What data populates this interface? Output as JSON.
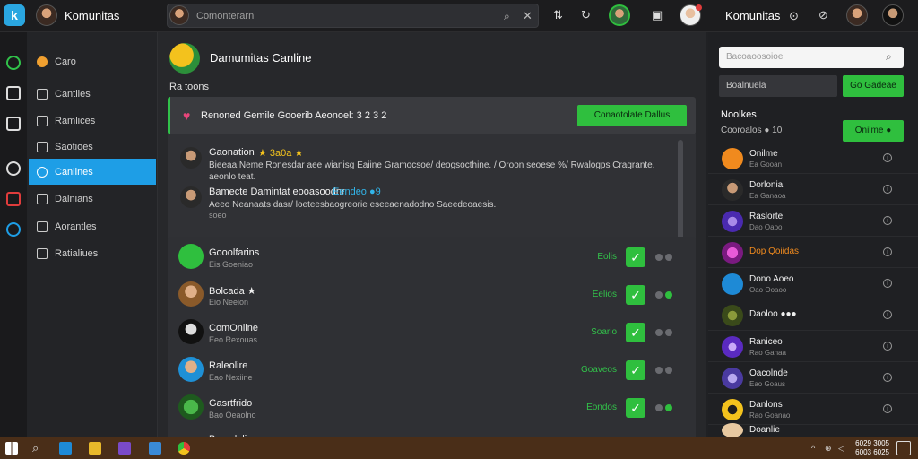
{
  "topbar": {
    "app_title": "Komunitas",
    "search_placeholder": "Comonterarn",
    "right_title": "Komunitas",
    "right_title_glyph": "⊙"
  },
  "nav": {
    "items": [
      {
        "label": "Caro"
      },
      {
        "label": "Cantlies"
      },
      {
        "label": "Ramlices"
      },
      {
        "label": "Saotioes"
      },
      {
        "label": "Canlines",
        "active": true
      },
      {
        "label": "Dalnians"
      },
      {
        "label": "Aorantles"
      },
      {
        "label": "Ratialiues"
      }
    ]
  },
  "main": {
    "title": "Damumitas Canline",
    "section_label": "Ra toons",
    "banner": {
      "text": "Renoned Gemile Gooerib Aeonoel: 3 2 3 2",
      "button": "Conaotolate Dallus"
    },
    "posts": [
      {
        "name": "Gaonation",
        "stars": "★ 3a0a ★",
        "text": "Bieeaa Neme Ronesdar aee wianisg Eaiine Gramocsoe/ deogsocthine. / Oroon seoese %/ Rwalogps Cragrante. aeonlo teat.",
        "sub": ""
      },
      {
        "name": "Bamecte Damintat eooasoodnr",
        "tag": "Eendeo ●9",
        "text": "Aeeo Neanaats dasr/ loeteesbaogreorie eseeaenadodno Saeedeoaesis.",
        "sub": "soeo"
      }
    ],
    "members": [
      {
        "name": "Gooolfarins",
        "sub": "Eis Goeniao",
        "status": "Eolis",
        "color": "#2fbf3e"
      },
      {
        "name": "Bolcada ★",
        "sub": "Eio Neeion",
        "status": "Eelios",
        "color": "#c08a5a"
      },
      {
        "name": "ComOnline",
        "sub": "Eeo Rexouas",
        "status": "Soario",
        "color": "#111111"
      },
      {
        "name": "Raleolire",
        "sub": "Eao Nexiine",
        "status": "Goaveos",
        "color": "#1e90d6"
      },
      {
        "name": "Gasrtfrido",
        "sub": "Bao Oeaolno",
        "status": "Eondos",
        "color": "#2a7a2a"
      },
      {
        "name": "Bavadolinu",
        "sub": "",
        "status": "",
        "color": "#555555"
      }
    ]
  },
  "right": {
    "search_placeholder": "Bacoaoosoioe",
    "input_placeholder": "Boalnuela",
    "input_button": "Go Gadeae",
    "heading": "Noolkes",
    "subheading": "Cooroalos ● 10",
    "online_button": "Onilme ●",
    "items": [
      {
        "name": "Onilme",
        "meta": "Ea Gooan",
        "color": "#f08a1e"
      },
      {
        "name": "Dorlonia",
        "meta": "Ea Ganaoa",
        "color": "#3a2a24"
      },
      {
        "name": "Raslorte",
        "meta": "Dao Oaoo",
        "color": "#6a4ac8"
      },
      {
        "name": "Dop Qoiidas",
        "meta": "",
        "color": "#b43ab0",
        "highlight": true
      },
      {
        "name": "Dono Aoeo",
        "meta": "Oao Ooaoo",
        "color": "#1e8ad6"
      },
      {
        "name": "Daoloo ●●●",
        "meta": "",
        "color": "#5a6a2a",
        "highlight2": true
      },
      {
        "name": "Raniceo",
        "meta": "Rao Ganaa",
        "color": "#7a4ad8"
      },
      {
        "name": "Oacolnde",
        "meta": "Eao Goaus",
        "color": "#6a4ac8"
      },
      {
        "name": "Danlons",
        "meta": "Rao Goanao",
        "color": "#f3c21d"
      },
      {
        "name": "Doanlie",
        "meta": "",
        "color": "#e8c8a0"
      }
    ]
  },
  "taskbar": {
    "clock_time": "6029 3005",
    "clock_date": "6003 6025"
  }
}
